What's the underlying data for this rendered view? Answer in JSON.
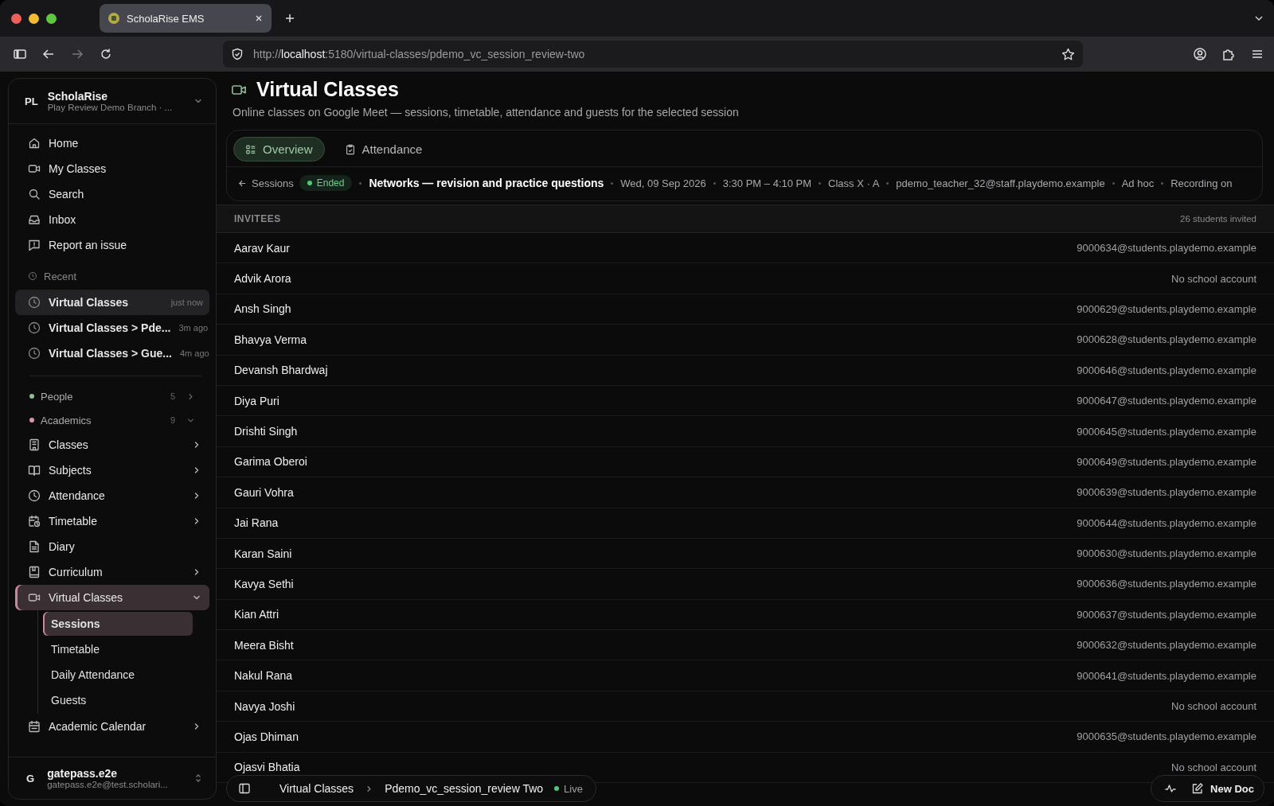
{
  "browser": {
    "tab_title": "ScholaRise EMS",
    "url_prefix": "http://",
    "url_host": "localhost",
    "url_rest": ":5180/virtual-classes/pdemo_vc_session_review-two"
  },
  "sidebar": {
    "org": {
      "initials": "PL",
      "name": "ScholaRise",
      "branch": "Play Review Demo Branch · ..."
    },
    "top_items": [
      "Home",
      "My Classes",
      "Search",
      "Inbox",
      "Report an issue"
    ],
    "recent_label": "Recent",
    "recent": [
      {
        "label": "Virtual Classes",
        "time": "just now",
        "selected": true
      },
      {
        "label": "Virtual Classes > Pde...",
        "time": "3m ago",
        "selected": false
      },
      {
        "label": "Virtual Classes > Gue...",
        "time": "4m ago",
        "selected": false
      }
    ],
    "groups": [
      {
        "label": "People",
        "count": "5",
        "color": "#8fbf94",
        "expanded": false
      },
      {
        "label": "Academics",
        "count": "9",
        "color": "#d99aa8",
        "expanded": true
      }
    ],
    "nav": [
      {
        "label": "Classes",
        "has_children": true,
        "expanded": false,
        "selected": false
      },
      {
        "label": "Subjects",
        "has_children": true,
        "expanded": false,
        "selected": false
      },
      {
        "label": "Attendance",
        "has_children": true,
        "expanded": false,
        "selected": false
      },
      {
        "label": "Timetable",
        "has_children": true,
        "expanded": false,
        "selected": false
      },
      {
        "label": "Diary",
        "has_children": false,
        "selected": false
      },
      {
        "label": "Curriculum",
        "has_children": true,
        "expanded": false,
        "selected": false
      },
      {
        "label": "Virtual Classes",
        "has_children": true,
        "expanded": true,
        "selected": true,
        "children": [
          {
            "label": "Sessions",
            "selected": true
          },
          {
            "label": "Timetable",
            "selected": false
          },
          {
            "label": "Daily Attendance",
            "selected": false
          },
          {
            "label": "Guests",
            "selected": false
          }
        ]
      },
      {
        "label": "Academic Calendar",
        "has_children": true,
        "expanded": false,
        "selected": false
      }
    ],
    "user": {
      "initial": "G",
      "name": "gatepass.e2e",
      "email": "gatepass.e2e@test.scholari..."
    }
  },
  "page": {
    "title": "Virtual Classes",
    "subtitle": "Online classes on Google Meet — sessions, timetable, attendance and guests for the selected session"
  },
  "tabs": [
    {
      "label": "Overview",
      "selected": true
    },
    {
      "label": "Attendance",
      "selected": false
    }
  ],
  "session": {
    "back": "Sessions",
    "status": "Ended",
    "title": "Networks — revision and practice questions",
    "meta": [
      "Wed, 09 Sep 2026",
      "3:30 PM – 4:10 PM",
      "Class X · A",
      "pdemo_teacher_32@staff.playdemo.example",
      "Ad hoc",
      "Recording on"
    ]
  },
  "invitees": {
    "heading": "INVITEES",
    "count": "26 students invited",
    "rows": [
      {
        "name": "Aarav Kaur",
        "account": "9000634@students.playdemo.example"
      },
      {
        "name": "Advik Arora",
        "account": "No school account"
      },
      {
        "name": "Ansh Singh",
        "account": "9000629@students.playdemo.example"
      },
      {
        "name": "Bhavya Verma",
        "account": "9000628@students.playdemo.example"
      },
      {
        "name": "Devansh Bhardwaj",
        "account": "9000646@students.playdemo.example"
      },
      {
        "name": "Diya Puri",
        "account": "9000647@students.playdemo.example"
      },
      {
        "name": "Drishti Singh",
        "account": "9000645@students.playdemo.example"
      },
      {
        "name": "Garima Oberoi",
        "account": "9000649@students.playdemo.example"
      },
      {
        "name": "Gauri Vohra",
        "account": "9000639@students.playdemo.example"
      },
      {
        "name": "Jai Rana",
        "account": "9000644@students.playdemo.example"
      },
      {
        "name": "Karan Saini",
        "account": "9000630@students.playdemo.example"
      },
      {
        "name": "Kavya Sethi",
        "account": "9000636@students.playdemo.example"
      },
      {
        "name": "Kian Attri",
        "account": "9000637@students.playdemo.example"
      },
      {
        "name": "Meera Bisht",
        "account": "9000632@students.playdemo.example"
      },
      {
        "name": "Nakul Rana",
        "account": "9000641@students.playdemo.example"
      },
      {
        "name": "Navya Joshi",
        "account": "No school account"
      },
      {
        "name": "Ojas Dhiman",
        "account": "9000635@students.playdemo.example"
      },
      {
        "name": "Ojasvi Bhatia",
        "account": "No school account"
      }
    ]
  },
  "bottom_bar": {
    "crumbs": [
      "Virtual Classes",
      "Pdemo_vc_session_review Two"
    ],
    "live": "Live",
    "new_doc": "New Doc"
  }
}
